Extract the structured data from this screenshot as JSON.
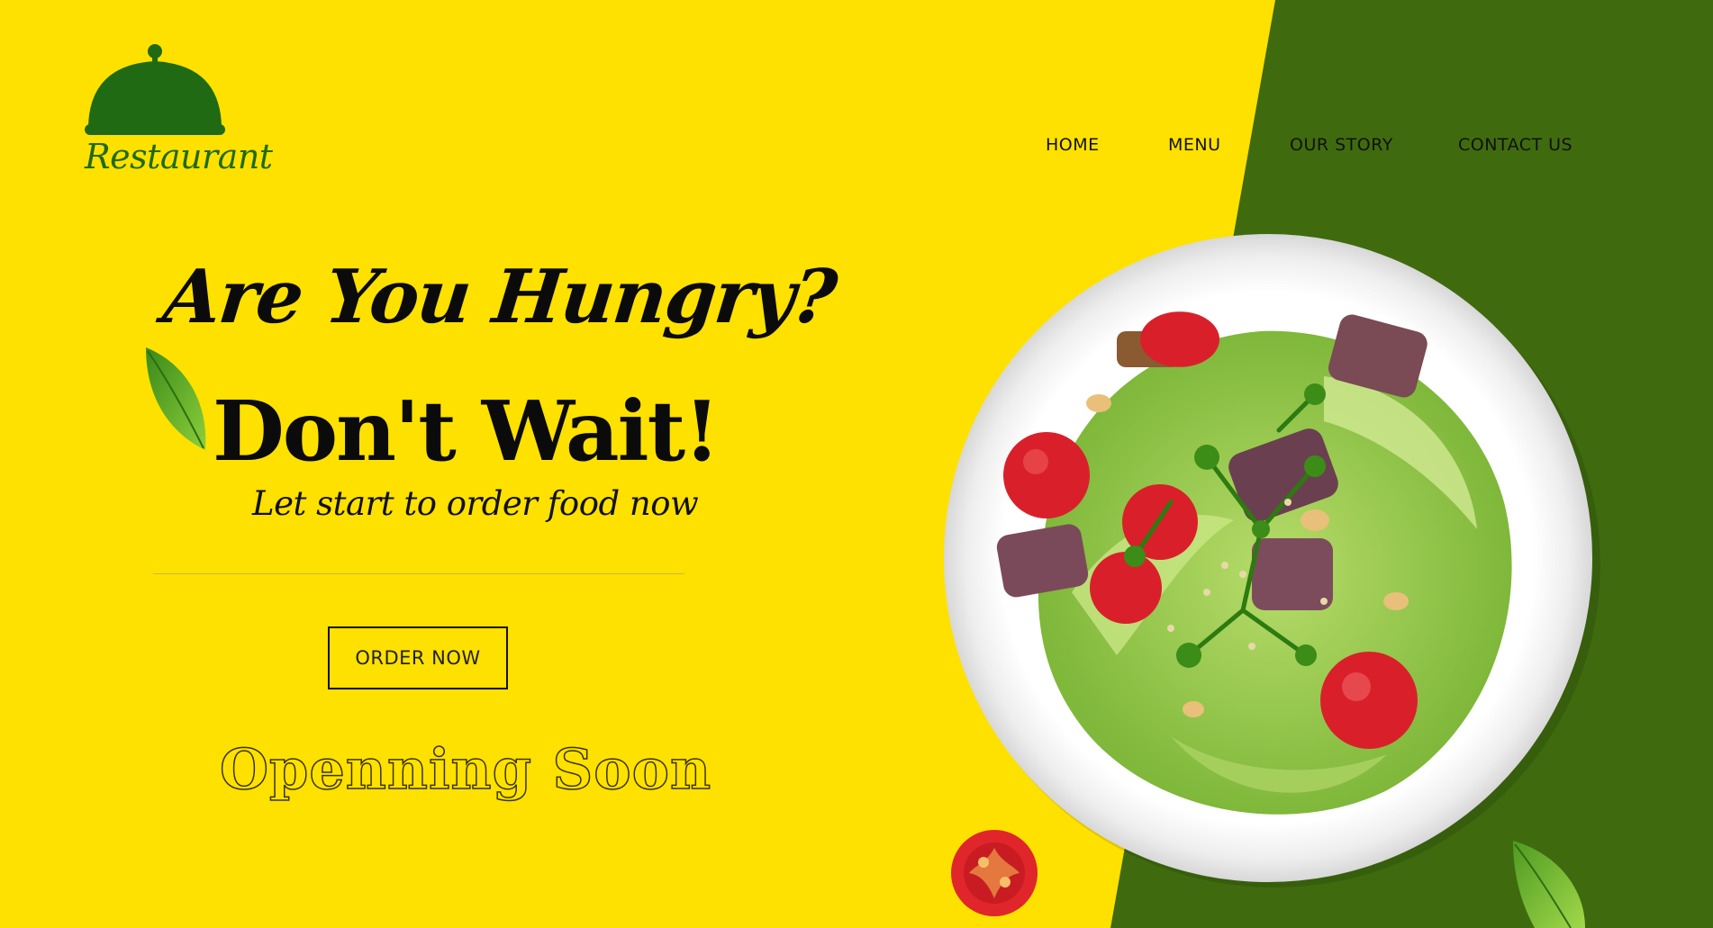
{
  "logo": {
    "text": "Restaurant",
    "icon": "cloche-icon"
  },
  "nav": {
    "items": [
      {
        "label": "HOME"
      },
      {
        "label": "MENU"
      },
      {
        "label": "OUR STORY"
      },
      {
        "label": "CONTACT US"
      }
    ]
  },
  "hero": {
    "title": "Are You Hungry?",
    "subtitle": "Don't Wait!",
    "tagline": "Let start to order food now",
    "order_button": "ORDER NOW",
    "opening": "Openning Soon"
  },
  "colors": {
    "background": "#ffe100",
    "panel": "#3f6b0e",
    "logo": "#1f6a12"
  },
  "images": {
    "salad": "salad-bowl-image",
    "tomato": "tomato-image",
    "leaf": "basil-leaf-image"
  }
}
